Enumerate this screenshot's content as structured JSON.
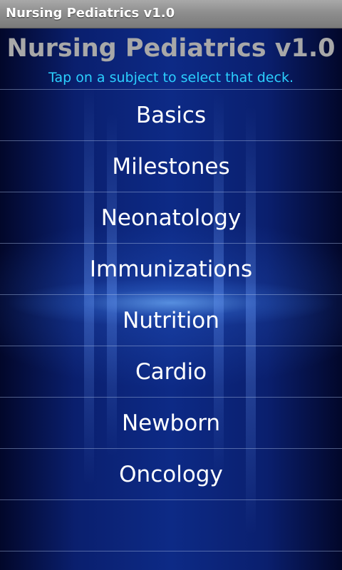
{
  "window": {
    "title": "Nursing Pediatrics v1.0"
  },
  "main": {
    "heading": "Nursing Pediatrics v1.0",
    "hint": "Tap on a subject to select that deck.",
    "decks": [
      {
        "label": "Basics"
      },
      {
        "label": "Milestones"
      },
      {
        "label": "Neonatology"
      },
      {
        "label": "Immunizations"
      },
      {
        "label": "Nutrition"
      },
      {
        "label": "Cardio"
      },
      {
        "label": "Newborn"
      },
      {
        "label": "Oncology"
      },
      {
        "label": ""
      }
    ]
  },
  "colors": {
    "heading": "#a8a8a8",
    "hint": "#2bd0ff",
    "deck_text": "#ffffff",
    "background": "#0d2a86"
  }
}
